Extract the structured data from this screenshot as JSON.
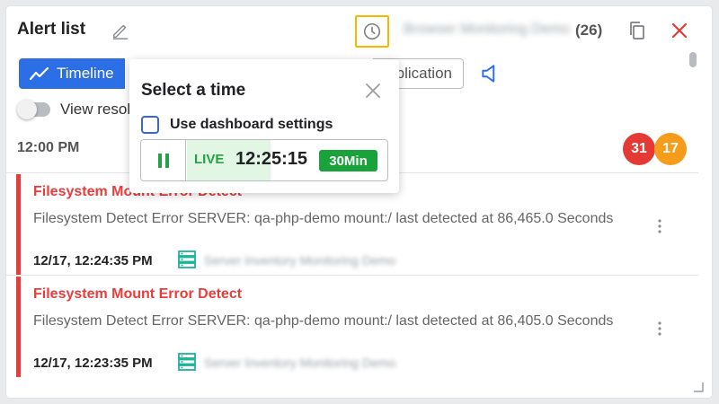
{
  "header": {
    "title": "Alert list",
    "project_name": "Browser Monitoring Demo",
    "count": "(26)"
  },
  "toolbar": {
    "timeline_label": "Timeline",
    "application_label": "Application",
    "view_toggle_label": "View resolved"
  },
  "time_marker": "12:00 PM",
  "badges": {
    "critical": "31",
    "warning": "17"
  },
  "colors": {
    "accent": "#2b6ee6",
    "critical": "#e53935",
    "warning": "#f59c1a",
    "live": "#1aa33a",
    "highlight": "#f5b800"
  },
  "alerts": [
    {
      "title": "Filesystem Mount Error Detect",
      "message": "Filesystem Detect Error SERVER: qa-php-demo mount:/ last detected at 86,465.0 Seconds",
      "time": "12/17, 12:24:35 PM",
      "server": "Server Inventory Monitoring Demo"
    },
    {
      "title": "Filesystem Mount Error Detect",
      "message": "Filesystem Detect Error SERVER: qa-php-demo mount:/ last detected at 86,405.0 Seconds",
      "time": "12/17, 12:23:35 PM",
      "server": "Server Inventory Monitoring Demo"
    }
  ],
  "time_popover": {
    "title": "Select a time",
    "checkbox_label": "Use dashboard settings",
    "live_label": "LIVE",
    "live_time": "12:25:15",
    "duration": "30Min"
  }
}
